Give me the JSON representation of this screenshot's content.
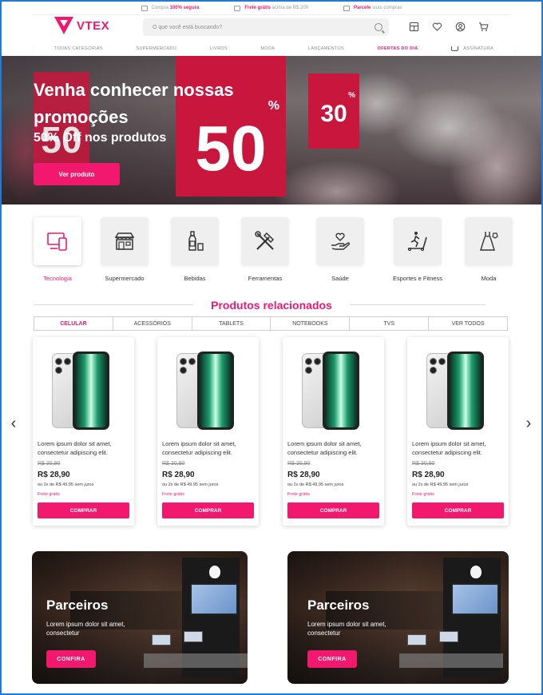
{
  "topbar": {
    "items": [
      {
        "pre": "Compra ",
        "bold": "100% segura",
        "post": "",
        "icon": "shield-icon"
      },
      {
        "pre": "",
        "bold": "Frete grátis",
        "post": " acima de R$ 200",
        "icon": "truck-icon"
      },
      {
        "pre": "",
        "bold": "Parcele",
        "post": " suas compras",
        "icon": "credit-card-icon"
      }
    ]
  },
  "header": {
    "logo": "VTEX",
    "search_placeholder": "O que você está buscando?"
  },
  "nav": {
    "items": [
      "TODAS CATEGORIAS",
      "SUPERMERCADO",
      "LIVROS",
      "MODA",
      "LANÇAMENTOS",
      "OFERTAS DO DIA",
      "ASSINATURA"
    ]
  },
  "hero": {
    "title": "Venha conhecer nossas promoções",
    "subtitle": "50% Off nos produtos",
    "button": "Ver produto",
    "sign_main": "50",
    "sign_small": "30",
    "sign_left": "50",
    "percent": "%"
  },
  "categories": [
    {
      "label": "Tecnologia",
      "icon": "devices-icon"
    },
    {
      "label": "Supermercado",
      "icon": "store-icon"
    },
    {
      "label": "Bebidas",
      "icon": "bottle-icon"
    },
    {
      "label": "Ferramentas",
      "icon": "tools-icon"
    },
    {
      "label": "Saúde",
      "icon": "heart-hand-icon"
    },
    {
      "label": "Esportes e Fitness",
      "icon": "treadmill-icon"
    },
    {
      "label": "Moda",
      "icon": "dress-icon"
    }
  ],
  "related": {
    "title": "Produtos relacionados",
    "tabs": [
      "CELULAR",
      "ACESSÓRIOS",
      "TABLETS",
      "NOTEBOOKS",
      "TVS",
      "VER TODOS"
    ]
  },
  "products": [
    {
      "desc": "Lorem ipsum dolor sit amet, consectetur adipiscing elit.",
      "old": "R$ 30,90",
      "price": "R$ 28,90",
      "installments": "ou 2x de R$ 49,95 sem juros",
      "shipping": "Frete grátis",
      "button": "COMPRAR"
    },
    {
      "desc": "Lorem ipsum dolor sit amet, consectetur adipiscing elit.",
      "old": "R$ 30,90",
      "price": "R$ 28,90",
      "installments": "ou 2x de R$ 49,95 sem juros",
      "shipping": "Frete grátis",
      "button": "COMPRAR"
    },
    {
      "desc": "Lorem ipsum dolor sit amet, consectetur adipiscing elit.",
      "old": "R$ 30,90",
      "price": "R$ 28,90",
      "installments": "ou 2x de R$ 49,95 sem juros",
      "shipping": "Frete grátis",
      "button": "COMPRAR"
    },
    {
      "desc": "Lorem ipsum dolor sit amet, consectetur adipiscing elit.",
      "old": "R$ 30,90",
      "price": "R$ 28,90",
      "installments": "ou 2x de R$ 49,95 sem juros",
      "shipping": "Frete grátis",
      "button": "COMPRAR"
    }
  ],
  "partners": [
    {
      "title": "Parceiros",
      "text": "Lorem ipsum dolor sit amet, consectetur",
      "button": "CONFIRA"
    },
    {
      "title": "Parceiros",
      "text": "Lorem ipsum dolor sit amet, consectetur",
      "button": "CONFIRA"
    }
  ],
  "carousel": {
    "prev": "‹",
    "next": "›"
  },
  "colors": {
    "accent": "#f2186e",
    "frame": "#1f7bd6"
  }
}
